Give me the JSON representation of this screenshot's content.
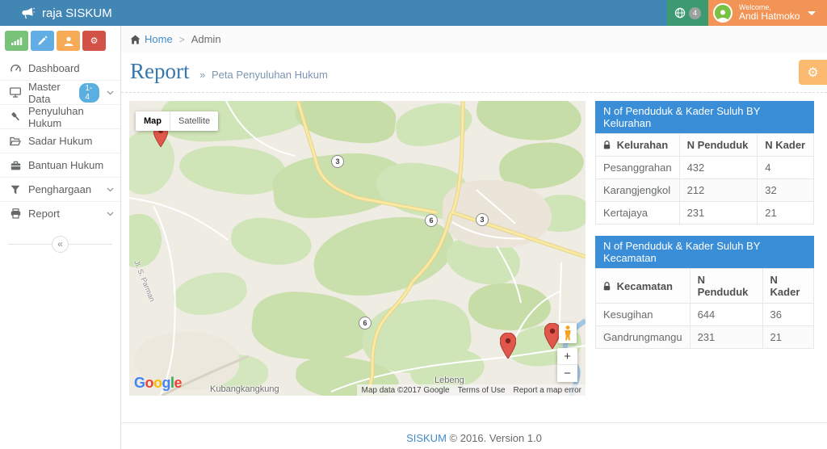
{
  "navbar": {
    "brand": "raja SISKUM",
    "notifications_count": "4",
    "welcome_label": "Welcome,",
    "user_name": "Andi Hatmoko"
  },
  "breadcrumb": {
    "home_label": "Home",
    "separator": ">",
    "current": "Admin"
  },
  "page_header": {
    "title": "Report",
    "separator": "»",
    "subtitle": "Peta Penyuluhan Hukum"
  },
  "sidebar": {
    "quick_buttons": [
      {
        "name": "chart-button"
      },
      {
        "name": "edit-button"
      },
      {
        "name": "user-button"
      },
      {
        "name": "settings-button",
        "glyph": "⚙"
      }
    ],
    "items": [
      {
        "label": "Dashboard"
      },
      {
        "label": "Master Data",
        "badge": "1-4",
        "has_submenu": true
      },
      {
        "label": "Penyuluhan Hukum"
      },
      {
        "label": "Sadar Hukum"
      },
      {
        "label": "Bantuan Hukum"
      },
      {
        "label": "Penghargaan",
        "has_submenu": true
      },
      {
        "label": "Report",
        "has_submenu": true
      }
    ],
    "collapse_glyph": "«"
  },
  "map": {
    "type_control": {
      "map": "Map",
      "satellite": "Satellite"
    },
    "route_shields": [
      {
        "label": "3"
      },
      {
        "label": "6"
      },
      {
        "label": "3"
      },
      {
        "label": "6"
      }
    ],
    "place_labels": [
      {
        "text": "Jl. S. Parman"
      },
      {
        "text": "Lebeng"
      },
      {
        "text": "Kubangkangkung"
      }
    ],
    "google_letters": [
      {
        "ch": "G"
      },
      {
        "ch": "o"
      },
      {
        "ch": "o"
      },
      {
        "ch": "g"
      },
      {
        "ch": "l"
      },
      {
        "ch": "e"
      }
    ],
    "attribution": {
      "map_data": "Map data ©2017 Google",
      "terms": "Terms of Use",
      "report_error": "Report a map error"
    },
    "zoom_in": "+",
    "zoom_out": "−"
  },
  "panels": [
    {
      "title": "N of Penduduk & Kader Suluh BY Kelurahan",
      "columns": [
        "Kelurahan",
        "N Penduduk",
        "N Kader"
      ],
      "rows": [
        [
          "Pesanggrahan",
          "432",
          "4"
        ],
        [
          "Karangjengkol",
          "212",
          "32"
        ],
        [
          "Kertajaya",
          "231",
          "21"
        ]
      ]
    },
    {
      "title": "N of Penduduk & Kader Suluh BY Kecamatan",
      "columns": [
        "Kecamatan",
        "N Penduduk",
        "N Kader"
      ],
      "rows": [
        [
          "Kesugihan",
          "644",
          "36"
        ],
        [
          "Gandrungmangu",
          "231",
          "21"
        ]
      ]
    }
  ],
  "footer": {
    "brand": "SISKUM",
    "text": "© 2016. Version 1.0"
  },
  "colors": {
    "navbar": "#4286b4",
    "navbar_green": "#3d9970",
    "navbar_orange": "#f19456",
    "table_header": "#3a8ed7",
    "link": "#428bca",
    "settings_button": "#fcba70",
    "quick_green": "#79c279",
    "quick_blue": "#62aee4",
    "quick_orange": "#f8ab57",
    "quick_red": "#d35248"
  }
}
